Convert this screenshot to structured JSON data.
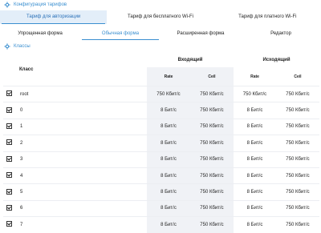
{
  "config_section": {
    "title": "Конфигурация тарифов",
    "icon": "gear-icon"
  },
  "tariff_tabs": [
    {
      "label": "Тариф для авторизации",
      "active": true
    },
    {
      "label": "Тариф для бесплатного Wi-Fi",
      "active": false
    },
    {
      "label": "Тариф для платного Wi-Fi",
      "active": false
    }
  ],
  "form_tabs": [
    {
      "label": "Упрощенная форма",
      "active": false
    },
    {
      "label": "Обычная форма",
      "active": true
    },
    {
      "label": "Расширенная форма",
      "active": false
    },
    {
      "label": "Редактор",
      "active": false
    }
  ],
  "classes_section": {
    "title": "Классы",
    "icon": "gear-icon"
  },
  "table": {
    "class_header": "Класс",
    "incoming_header": "Входящий",
    "outgoing_header": "Исходящий",
    "rate_header": "Rate",
    "ceil_header": "Ceil",
    "rows": [
      {
        "name": "root",
        "checked": true,
        "in_rate": "750 Кбит/с",
        "in_ceil": "750 Кбит/с",
        "out_rate": "750 Кбит/с",
        "out_ceil": "750 Кбит/с"
      },
      {
        "name": "0",
        "checked": true,
        "in_rate": "8 Бит/с",
        "in_ceil": "750 Кбит/с",
        "out_rate": "8 Бит/с",
        "out_ceil": "750 Кбит/с"
      },
      {
        "name": "1",
        "checked": true,
        "in_rate": "8 Бит/с",
        "in_ceil": "750 Кбит/с",
        "out_rate": "8 Бит/с",
        "out_ceil": "750 Кбит/с"
      },
      {
        "name": "2",
        "checked": true,
        "in_rate": "8 Бит/с",
        "in_ceil": "750 Кбит/с",
        "out_rate": "8 Бит/с",
        "out_ceil": "750 Кбит/с"
      },
      {
        "name": "3",
        "checked": true,
        "in_rate": "8 Бит/с",
        "in_ceil": "750 Кбит/с",
        "out_rate": "8 Бит/с",
        "out_ceil": "750 Кбит/с"
      },
      {
        "name": "4",
        "checked": true,
        "in_rate": "8 Бит/с",
        "in_ceil": "750 Кбит/с",
        "out_rate": "8 Бит/с",
        "out_ceil": "750 Кбит/с"
      },
      {
        "name": "5",
        "checked": true,
        "in_rate": "8 Бит/с",
        "in_ceil": "750 Кбит/с",
        "out_rate": "8 Бит/с",
        "out_ceil": "750 Кбит/с"
      },
      {
        "name": "6",
        "checked": true,
        "in_rate": "8 Бит/с",
        "in_ceil": "750 Кбит/с",
        "out_rate": "8 Бит/с",
        "out_ceil": "750 Кбит/с"
      },
      {
        "name": "7",
        "checked": true,
        "in_rate": "8 Бит/с",
        "in_ceil": "750 Кбит/с",
        "out_rate": "8 Бит/с",
        "out_ceil": "750 Кбит/с"
      }
    ]
  },
  "colors": {
    "accent": "#3a8fd0",
    "active_tab_bg": "#e3eef9",
    "column_highlight": "#f0f2f6"
  }
}
